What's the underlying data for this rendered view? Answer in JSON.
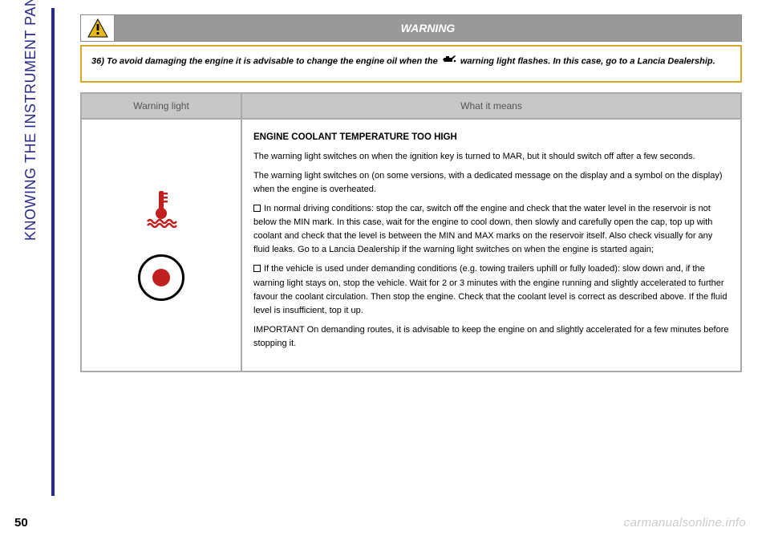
{
  "sidebar": {
    "prefix": "KNOWING ",
    "suffix": "THE INSTRUMENT PANEL"
  },
  "warning": {
    "header": "WARNING",
    "text_before": "36) To avoid damaging the engine it is advisable to change the engine oil when the ",
    "text_after": " warning light flashes. In this case, go to a Lancia Dealership."
  },
  "table": {
    "head_left": "Warning light",
    "head_right": "What it means",
    "body": {
      "title": "ENGINE COOLANT TEMPERATURE TOO HIGH",
      "p1": "The warning light switches on when the ignition key is turned to MAR, but it should switch off after a few seconds.",
      "p2": "The warning light switches on (on some versions, with a dedicated message on the display and a symbol on the display) when the engine is overheated.",
      "b1": "In normal driving conditions: stop the car, switch off the engine and check that the water level in the reservoir is not below the MIN mark. In this case, wait for the engine to cool down, then slowly and carefully open the cap, top up with coolant and check that the level is between the MIN and MAX marks on the reservoir itself. Also check visually for any fluid leaks. Go to a Lancia Dealership if the warning light switches on when the engine is started again;",
      "b2": "If the vehicle is used under demanding conditions (e.g. towing trailers uphill or fully loaded): slow down and, if the warning light stays on, stop the vehicle. Wait for 2 or 3 minutes with the engine running and slightly accelerated to further favour the coolant circulation. Then stop the engine. Check that the coolant level is correct as described above. If the fluid level is insufficient, top it up.",
      "important": "IMPORTANT On demanding routes, it is advisable to keep the engine on and slightly accelerated for a few minutes before stopping it."
    }
  },
  "page": "50",
  "watermark": "carmanualsonline.info"
}
